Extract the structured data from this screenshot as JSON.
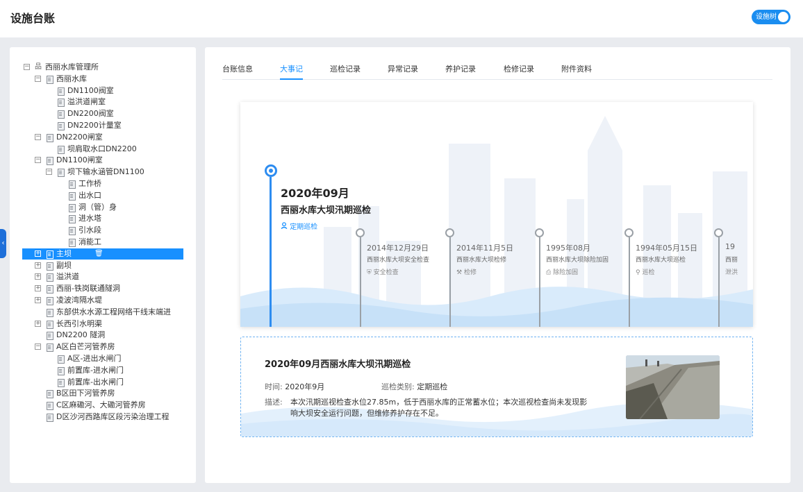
{
  "header": {
    "title": "设施台账",
    "toggle_label": "设施树"
  },
  "tree": [
    {
      "label": "西丽水库管理所",
      "toggle": "−",
      "icon": "org"
    },
    {
      "label": "西丽水库",
      "toggle": "−"
    },
    {
      "label": "DN1100阀室"
    },
    {
      "label": "溢洪道闸室"
    },
    {
      "label": "DN2200阀室"
    },
    {
      "label": "DN2200计量室"
    },
    {
      "label": "DN2200闸室",
      "toggle": "−"
    },
    {
      "label": "坝肩取水口DN2200"
    },
    {
      "label": "DN1100闸室",
      "toggle": "−"
    },
    {
      "label": "坝下输水涵管DN1100",
      "toggle": "−"
    },
    {
      "label": "工作桥"
    },
    {
      "label": "出水口"
    },
    {
      "label": "洞（管）身"
    },
    {
      "label": "进水塔"
    },
    {
      "label": "引水段"
    },
    {
      "label": "消能工"
    },
    {
      "label": "主坝",
      "toggle": "+",
      "selected": true
    },
    {
      "label": "副坝",
      "toggle": "+"
    },
    {
      "label": "溢洪道",
      "toggle": "+"
    },
    {
      "label": "西丽-铁岗联通隧洞",
      "toggle": "+"
    },
    {
      "label": "凌波湾隔水堤",
      "toggle": "+"
    },
    {
      "label": "东部供水水源工程网络干线末端进"
    },
    {
      "label": "长西引水明渠",
      "toggle": "+"
    },
    {
      "label": "DN2200 隧洞"
    },
    {
      "label": "A区白芒河管养房",
      "toggle": "−"
    },
    {
      "label": "A区-进出水闸门"
    },
    {
      "label": "前置库-进水闸门"
    },
    {
      "label": "前置库-出水闸门"
    },
    {
      "label": "B区田下河管养房"
    },
    {
      "label": "C区麻磡河、大磡河管养房"
    },
    {
      "label": "D区沙河西路库区段污染治理工程"
    }
  ],
  "tabs": [
    "台账信息",
    "大事记",
    "巡检记录",
    "异常记录",
    "养护记录",
    "检修记录",
    "附件资料"
  ],
  "active_tab": "大事记",
  "timeline": {
    "featured": {
      "date": "2020年09月",
      "title": "西丽水库大坝汛期巡检",
      "type": "定期巡检",
      "type_icon": "person-pin-icon"
    },
    "events": [
      {
        "date": "2014年12月29日",
        "title": "西丽水库大坝安全检查",
        "type": "安全检查",
        "icon": "shield-icon"
      },
      {
        "date": "2014年11月5日",
        "title": "西丽水库大坝检修",
        "type": "检修",
        "icon": "tools-icon"
      },
      {
        "date": "1995年08月",
        "title": "西丽水库大坝除险加固",
        "type": "除险加固",
        "icon": "printer-icon"
      },
      {
        "date": "1994年05月15日",
        "title": "西丽水库大坝巡检",
        "type": "巡检",
        "icon": "person-icon"
      },
      {
        "date": "19",
        "title": "西丽",
        "type": "泄洪",
        "icon": ""
      }
    ]
  },
  "detail": {
    "title": "2020年09月西丽水库大坝汛期巡检",
    "time_label": "时间:",
    "time_value": "2020年9月",
    "category_label": "巡检类别:",
    "category_value": "定期巡检",
    "desc_label": "描述:",
    "desc_value": "本次汛期巡视检查水位27.85m，低于西丽水库的正常蓄水位；本次巡视检查尚未发现影响大坝安全运行问题，但维修养护存在不足。"
  },
  "colors": {
    "accent": "#1890ff",
    "background": "#e9ebef",
    "panel": "#ffffff"
  }
}
